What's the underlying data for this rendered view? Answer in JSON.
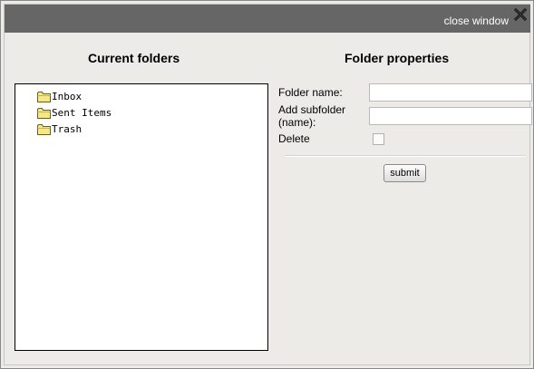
{
  "titlebar": {
    "close_label": "close window",
    "close_icon": "close-x-icon"
  },
  "left_panel": {
    "heading": "Current folders",
    "folders": [
      {
        "label": "Inbox",
        "icon": "folder-icon"
      },
      {
        "label": "Sent Items",
        "icon": "folder-icon"
      },
      {
        "label": "Trash",
        "icon": "folder-icon"
      }
    ]
  },
  "right_panel": {
    "heading": "Folder properties",
    "folder_name_label": "Folder name:",
    "folder_name_value": "",
    "subfolder_label_line1": "Add subfolder",
    "subfolder_label_line2": "(name):",
    "subfolder_value": "",
    "delete_label": "Delete",
    "delete_checked": false,
    "submit_label": "submit"
  },
  "colors": {
    "titlebar_bg": "#666666",
    "panel_bg": "#edebe7",
    "folder_yellow": "#f2e37a"
  }
}
